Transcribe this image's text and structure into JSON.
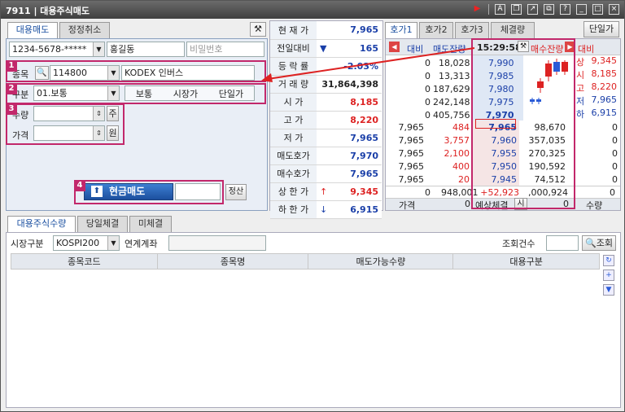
{
  "title": "7911 | 대용주식매도",
  "left": {
    "tabs": [
      "대용매도",
      "정정취소"
    ],
    "account": "1234-5678-*****",
    "name": "홍길동",
    "password_placeholder": "비밀번호",
    "stock_label": "종목",
    "stock_code": "114800",
    "stock_name": "KODEX 인버스",
    "type_label": "구분",
    "type_value": "01.보통",
    "type_options": [
      "보통",
      "시장가",
      "단일가"
    ],
    "qty_label": "수량",
    "qty_unit": "주",
    "price_label": "가격",
    "price_unit": "원",
    "sell_button": "현금매도",
    "calc_button": "정산"
  },
  "steps": [
    "1",
    "2",
    "3",
    "4"
  ],
  "price": [
    {
      "k": "현 재 가",
      "v": "7,965",
      "c": "blue"
    },
    {
      "k": "전일대비",
      "v": "165",
      "c": "blue",
      "arrow": "▼"
    },
    {
      "k": "등 락 률",
      "v": "-2.03%",
      "c": "blue"
    },
    {
      "k": "거 래 량",
      "v": "31,864,398",
      "c": ""
    },
    {
      "k": "시   가",
      "v": "8,185",
      "c": "red"
    },
    {
      "k": "고   가",
      "v": "8,220",
      "c": "red"
    },
    {
      "k": "저   가",
      "v": "7,965",
      "c": "blue"
    },
    {
      "k": "매도호가",
      "v": "7,970",
      "c": "blue"
    },
    {
      "k": "매수호가",
      "v": "7,965",
      "c": "blue"
    },
    {
      "k": "상 한 가",
      "v": "9,345",
      "c": "red",
      "arrow": "↑"
    },
    {
      "k": "하 한 가",
      "v": "6,915",
      "c": "blue",
      "arrow": "↓"
    }
  ],
  "ob": {
    "tabs": [
      "호가1",
      "호가2",
      "호가3",
      "체결량"
    ],
    "single_btn": "단일가",
    "hdr": {
      "diff": "대비",
      "ask": "매도잔량",
      "time": "15:29:58",
      "bid": "매수잔량",
      "diff2": "대비"
    },
    "ask_rows": [
      {
        "d": "0",
        "q": "18,028",
        "p": "7,990"
      },
      {
        "d": "0",
        "q": "13,313",
        "p": "7,985"
      },
      {
        "d": "0",
        "q": "187,629",
        "p": "7,980"
      },
      {
        "d": "0",
        "q": "242,148",
        "p": "7,975"
      },
      {
        "d": "0",
        "q": "405,756",
        "p": "7,970"
      }
    ],
    "bid_rows": [
      {
        "a": "7,965",
        "b": "484",
        "p": "7,965",
        "q": "98,670",
        "d": "0"
      },
      {
        "a": "7,965",
        "b": "3,757",
        "p": "7,960",
        "q": "357,035",
        "d": "0"
      },
      {
        "a": "7,965",
        "b": "2,100",
        "p": "7,955",
        "q": "270,325",
        "d": "0"
      },
      {
        "a": "7,965",
        "b": "400",
        "p": "7,950",
        "q": "190,592",
        "d": "0"
      },
      {
        "a": "7,965",
        "b": "20",
        "p": "7,945",
        "q": "74,512",
        "d": "0"
      }
    ],
    "summary": {
      "d": "0",
      "ask_total": "948,001",
      "diff": "+52,923",
      "bid_total": ",000,924",
      "d2": "0"
    },
    "right_info": [
      {
        "k": "상",
        "v": "9,345",
        "c": "red"
      },
      {
        "k": "시",
        "v": "8,185",
        "c": "red"
      },
      {
        "k": "고",
        "v": "8,220",
        "c": "red"
      },
      {
        "k": "저",
        "v": "7,965",
        "c": "blue"
      },
      {
        "k": "하",
        "v": "6,915",
        "c": "blue"
      }
    ],
    "footer": {
      "price": "가격",
      "price_val": "0",
      "expected": "예상체결",
      "si": "시",
      "exp_val": "0",
      "qty": "수량"
    }
  },
  "bottom": {
    "tabs": [
      "대용주식수량",
      "당일체결",
      "미체결"
    ],
    "market_label": "시장구분",
    "market_value": "KOSPI200",
    "linked_label": "연계계좌",
    "count_label": "조회건수",
    "query_button": "조회",
    "columns": [
      "종목코드",
      "종목명",
      "매도가능수량",
      "대용구분"
    ]
  }
}
